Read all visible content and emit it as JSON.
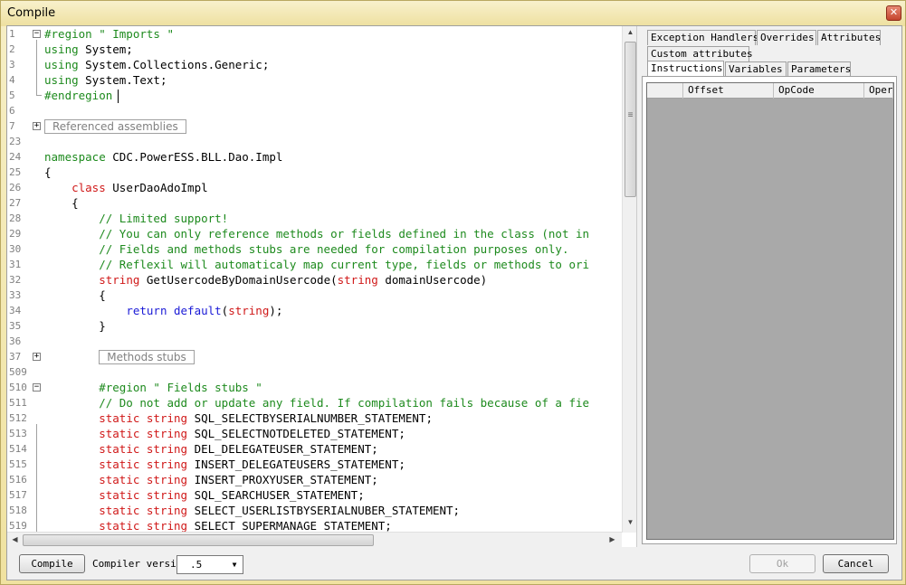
{
  "window": {
    "title": "Compile",
    "close_glyph": "✕"
  },
  "editor": {
    "lines": [
      {
        "n": "1",
        "parts": [
          {
            "c": "kw-g",
            "t": "#region \" Imports \""
          }
        ]
      },
      {
        "n": "2",
        "parts": [
          {
            "c": "kw-g",
            "t": "using "
          },
          {
            "c": "",
            "t": "System;"
          }
        ]
      },
      {
        "n": "3",
        "parts": [
          {
            "c": "kw-g",
            "t": "using "
          },
          {
            "c": "",
            "t": "System.Collections.Generic;"
          }
        ]
      },
      {
        "n": "4",
        "parts": [
          {
            "c": "kw-g",
            "t": "using "
          },
          {
            "c": "",
            "t": "System.Text;"
          }
        ]
      },
      {
        "n": "5",
        "parts": [
          {
            "c": "kw-g",
            "t": "#endregion"
          }
        ]
      },
      {
        "n": "6",
        "parts": []
      },
      {
        "n": "7",
        "collapsed": "Referenced assemblies"
      },
      {
        "n": "23",
        "parts": []
      },
      {
        "n": "24",
        "parts": [
          {
            "c": "kw-g",
            "t": "namespace "
          },
          {
            "c": "",
            "t": "CDC.PowerESS.BLL.Dao.Impl"
          }
        ]
      },
      {
        "n": "25",
        "parts": [
          {
            "c": "",
            "t": "{"
          }
        ]
      },
      {
        "n": "26",
        "parts": [
          {
            "c": "",
            "t": "    "
          },
          {
            "c": "kw-r",
            "t": "class "
          },
          {
            "c": "",
            "t": "UserDaoAdoImpl"
          }
        ]
      },
      {
        "n": "27",
        "parts": [
          {
            "c": "",
            "t": "    {"
          }
        ]
      },
      {
        "n": "28",
        "parts": [
          {
            "c": "cm",
            "t": "        // Limited support!"
          }
        ]
      },
      {
        "n": "29",
        "parts": [
          {
            "c": "cm",
            "t": "        // You can only reference methods or fields defined in the class (not in"
          }
        ]
      },
      {
        "n": "30",
        "parts": [
          {
            "c": "cm",
            "t": "        // Fields and methods stubs are needed for compilation purposes only."
          }
        ]
      },
      {
        "n": "31",
        "parts": [
          {
            "c": "cm",
            "t": "        // Reflexil will automaticaly map current type, fields or methods to ori"
          }
        ]
      },
      {
        "n": "32",
        "parts": [
          {
            "c": "",
            "t": "        "
          },
          {
            "c": "kw-r",
            "t": "string "
          },
          {
            "c": "",
            "t": "GetUsercodeByDomainUsercode("
          },
          {
            "c": "kw-r",
            "t": "string "
          },
          {
            "c": "",
            "t": "domainUsercode)"
          }
        ]
      },
      {
        "n": "33",
        "parts": [
          {
            "c": "",
            "t": "        {"
          }
        ]
      },
      {
        "n": "34",
        "parts": [
          {
            "c": "",
            "t": "            "
          },
          {
            "c": "kw-b",
            "t": "return default"
          },
          {
            "c": "",
            "t": "("
          },
          {
            "c": "kw-r",
            "t": "string"
          },
          {
            "c": "",
            "t": ");"
          }
        ]
      },
      {
        "n": "35",
        "parts": [
          {
            "c": "",
            "t": "        }"
          }
        ]
      },
      {
        "n": "36",
        "parts": []
      },
      {
        "n": "37",
        "collapsed": "Methods stubs",
        "indent": "        "
      },
      {
        "n": "509",
        "parts": []
      },
      {
        "n": "510",
        "parts": [
          {
            "c": "",
            "t": "        "
          },
          {
            "c": "kw-g",
            "t": "#region \" Fields stubs \""
          }
        ]
      },
      {
        "n": "511",
        "parts": [
          {
            "c": "cm",
            "t": "        // Do not add or update any field. If compilation fails because of a fie"
          }
        ]
      },
      {
        "n": "512",
        "parts": [
          {
            "c": "",
            "t": "        "
          },
          {
            "c": "kw-r",
            "t": "static string "
          },
          {
            "c": "",
            "t": "SQL_SELECTBYSERIALNUMBER_STATEMENT;"
          }
        ]
      },
      {
        "n": "513",
        "parts": [
          {
            "c": "",
            "t": "        "
          },
          {
            "c": "kw-r",
            "t": "static string "
          },
          {
            "c": "",
            "t": "SQL_SELECTNOTDELETED_STATEMENT;"
          }
        ]
      },
      {
        "n": "514",
        "parts": [
          {
            "c": "",
            "t": "        "
          },
          {
            "c": "kw-r",
            "t": "static string "
          },
          {
            "c": "",
            "t": "DEL_DELEGATEUSER_STATEMENT;"
          }
        ]
      },
      {
        "n": "515",
        "parts": [
          {
            "c": "",
            "t": "        "
          },
          {
            "c": "kw-r",
            "t": "static string "
          },
          {
            "c": "",
            "t": "INSERT_DELEGATEUSERS_STATEMENT;"
          }
        ]
      },
      {
        "n": "516",
        "parts": [
          {
            "c": "",
            "t": "        "
          },
          {
            "c": "kw-r",
            "t": "static string "
          },
          {
            "c": "",
            "t": "INSERT_PROXYUSER_STATEMENT;"
          }
        ]
      },
      {
        "n": "517",
        "parts": [
          {
            "c": "",
            "t": "        "
          },
          {
            "c": "kw-r",
            "t": "static string "
          },
          {
            "c": "",
            "t": "SQL_SEARCHUSER_STATEMENT;"
          }
        ]
      },
      {
        "n": "518",
        "parts": [
          {
            "c": "",
            "t": "        "
          },
          {
            "c": "kw-r",
            "t": "static string "
          },
          {
            "c": "",
            "t": "SELECT_USERLISTBYSERIALNUBER_STATEMENT;"
          }
        ]
      },
      {
        "n": "519",
        "parts": [
          {
            "c": "",
            "t": "        "
          },
          {
            "c": "kw-r",
            "t": "static string "
          },
          {
            "c": "",
            "t": "SELECT_SUPERMANAGE_STATEMENT;"
          }
        ]
      }
    ]
  },
  "scroll": {
    "up": "▲",
    "down": "▼",
    "left": "◀",
    "right": "▶",
    "grip": "≡"
  },
  "tabs": {
    "row1": [
      "Exception Handlers",
      "Overrides",
      "Attributes"
    ],
    "row2": [
      "Custom attributes"
    ],
    "row3": [
      "Instructions",
      "Variables",
      "Parameters"
    ],
    "active": "Instructions"
  },
  "grid": {
    "columns": [
      "",
      "Offset",
      "OpCode",
      "Oper"
    ]
  },
  "bottom": {
    "compile_label": "Compile",
    "compiler_version_label": "Compiler version:",
    "compiler_version_value": ".5",
    "ok_label": "Ok",
    "cancel_label": "Cancel"
  }
}
